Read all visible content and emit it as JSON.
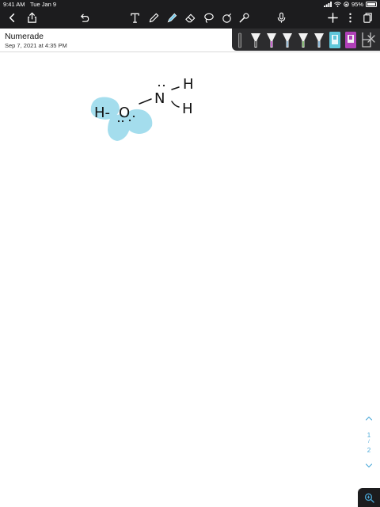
{
  "status_bar": {
    "time": "9:41 AM",
    "date": "Tue Jan 9",
    "battery": "95%"
  },
  "toolbar": {
    "icons": [
      "back-chevron-icon",
      "share-icon",
      "undo-icon",
      "text-tool-icon",
      "pen-tool-icon",
      "highlighter-tool-icon",
      "eraser-tool-icon",
      "lasso-tool-icon",
      "shapes-tool-icon",
      "laser-pointer-icon",
      "microphone-icon",
      "add-icon",
      "more-icon",
      "pages-icon"
    ]
  },
  "document": {
    "title": "Numerade",
    "date": "Sep 7, 2021 at 4:35 PM"
  },
  "pen_tray": {
    "colors": [
      "#3c3c3c",
      "#c040c8",
      "#8ab6d6",
      "#6fae57",
      "#7ab2d6",
      "#5fc7da",
      "#b040b8",
      "#7a7a7a"
    ]
  },
  "canvas": {
    "handwriting": {
      "hydrogen_left": "H-",
      "oxygen": "O",
      "nitrogen": "N",
      "hydrogen_top": "H",
      "hydrogen_bottom": "H"
    },
    "highlight_color": "#5bc3e0"
  },
  "pager": {
    "current": "1",
    "separator": "/",
    "total": "2"
  },
  "colors": {
    "toolbar_bg": "#1c1c1e",
    "accent": "#4aa8d8"
  }
}
